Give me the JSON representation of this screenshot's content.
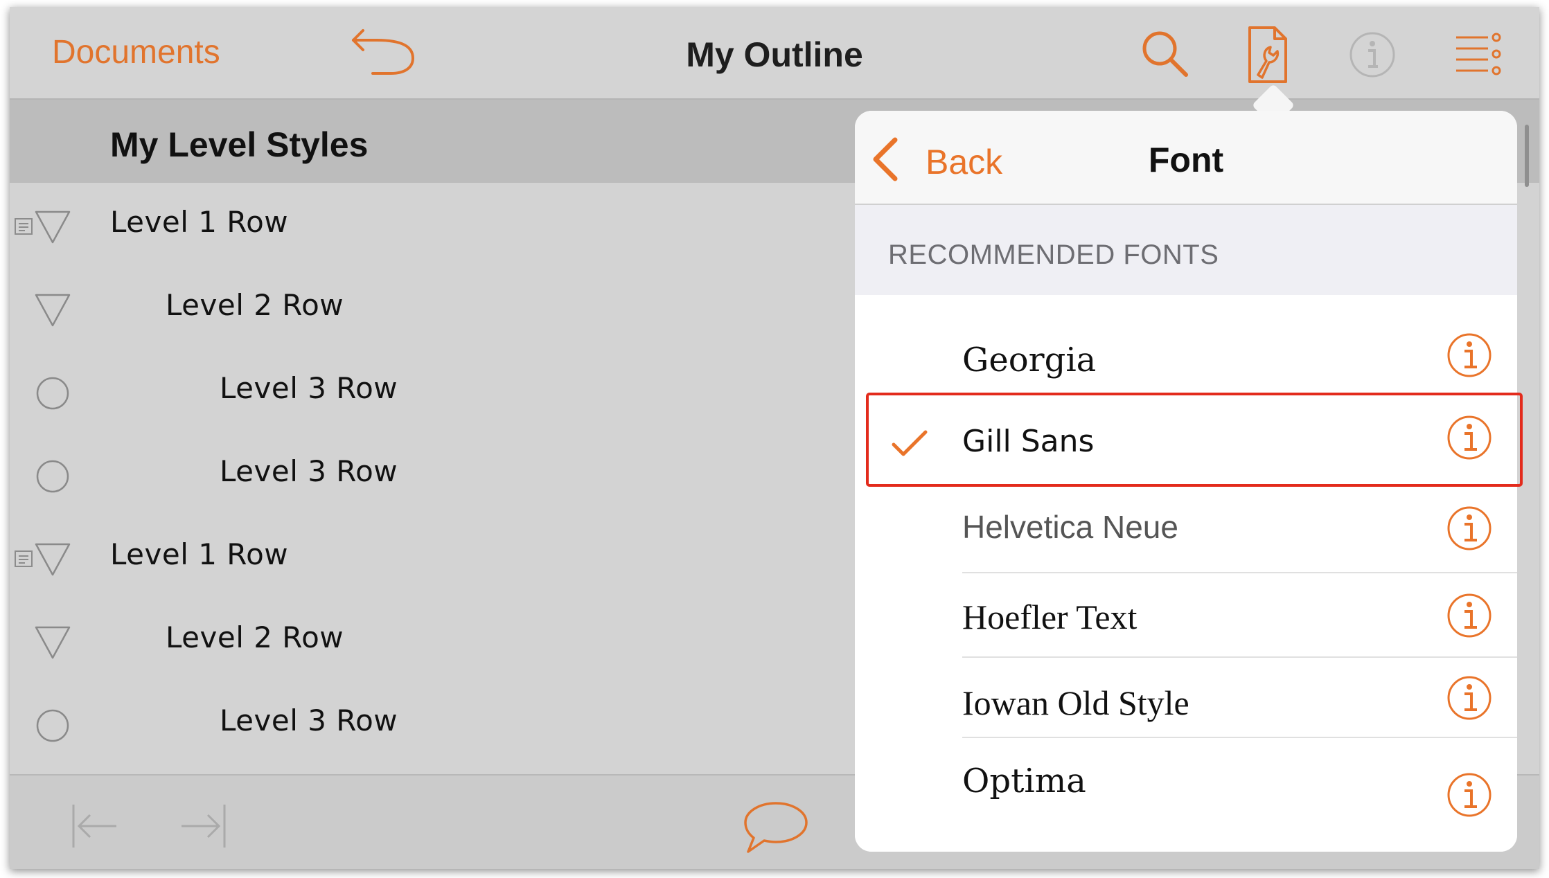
{
  "toolbar": {
    "documents_label": "Documents",
    "title": "My Outline",
    "icons": [
      "undo-icon",
      "search-icon",
      "inspector-icon",
      "info-icon",
      "view-options-icon"
    ]
  },
  "outline": {
    "section_title": "My Level Styles",
    "rows": [
      {
        "label": "Level 1 Row",
        "level": 1,
        "handle": "disclosure-triangle-icon",
        "has_note": true
      },
      {
        "label": "Level 2 Row",
        "level": 2,
        "handle": "disclosure-triangle-icon",
        "has_note": false
      },
      {
        "label": "Level 3 Row",
        "level": 3,
        "handle": "circle-bullet-icon",
        "has_note": false
      },
      {
        "label": "Level 3 Row",
        "level": 3,
        "handle": "circle-bullet-icon",
        "has_note": false
      },
      {
        "label": "Level 1 Row",
        "level": 1,
        "handle": "disclosure-triangle-icon",
        "has_note": true
      },
      {
        "label": "Level 2 Row",
        "level": 2,
        "handle": "disclosure-triangle-icon",
        "has_note": false
      },
      {
        "label": "Level 3 Row",
        "level": 3,
        "handle": "circle-bullet-icon",
        "has_note": false
      }
    ]
  },
  "bottombar": {
    "icons": [
      "outdent-icon",
      "indent-icon",
      "note-bubble-icon"
    ]
  },
  "popover": {
    "back_label": "Back",
    "title": "Font",
    "section_label": "RECOMMENDED FONTS",
    "fonts": [
      {
        "name": "Georgia",
        "selected": false
      },
      {
        "name": "Gill Sans",
        "selected": true
      },
      {
        "name": "Helvetica Neue",
        "selected": false
      },
      {
        "name": "Hoefler Text",
        "selected": false
      },
      {
        "name": "Iowan Old Style",
        "selected": false
      },
      {
        "name": "Optima",
        "selected": false
      }
    ]
  },
  "colors": {
    "accent": "#e9742a",
    "highlight_border": "#e32b1c",
    "toolbar_bg": "#d4d4d4",
    "section_bg": "#bcbcbc",
    "popover_bg": "#ffffff",
    "popover_section_bg": "#efeff4"
  }
}
